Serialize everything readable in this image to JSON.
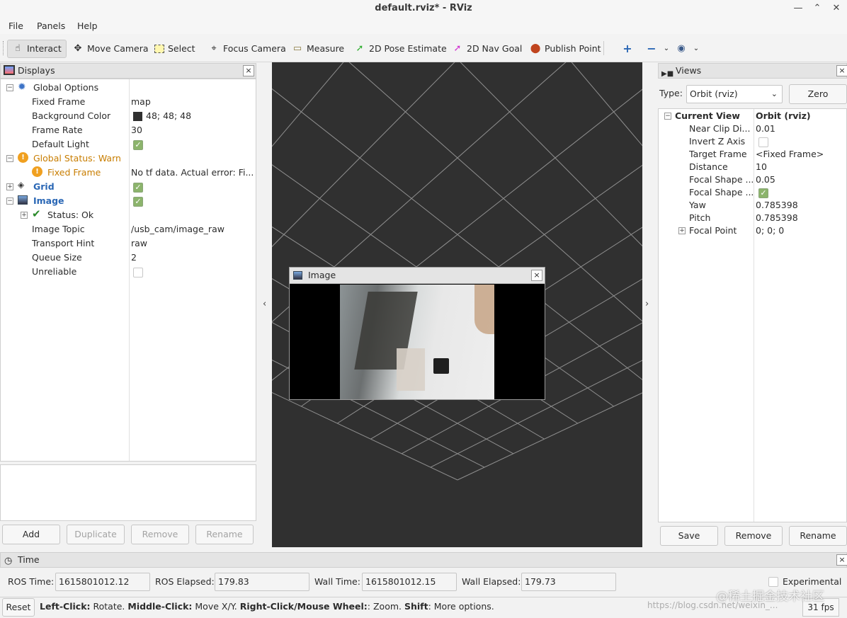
{
  "window": {
    "title": "default.rviz* - RViz"
  },
  "menu": {
    "file": "File",
    "panels": "Panels",
    "help": "Help"
  },
  "toolbar": {
    "interact": "Interact",
    "move_camera": "Move Camera",
    "select": "Select",
    "focus_camera": "Focus Camera",
    "measure": "Measure",
    "pose_estimate": "2D Pose Estimate",
    "nav_goal": "2D Nav Goal",
    "publish_point": "Publish Point"
  },
  "displays": {
    "title": "Displays",
    "rows": {
      "global_options": "Global Options",
      "fixed_frame": "Fixed Frame",
      "fixed_frame_val": "map",
      "background_color": "Background Color",
      "background_color_val": "48; 48; 48",
      "frame_rate": "Frame Rate",
      "frame_rate_val": "30",
      "default_light": "Default Light",
      "global_status": "Global Status: Warn",
      "fixed_frame_status": "Fixed Frame",
      "fixed_frame_status_val": "No tf data.  Actual error: Fi...",
      "grid": "Grid",
      "image": "Image",
      "status_ok": "Status: Ok",
      "image_topic": "Image Topic",
      "image_topic_val": "/usb_cam/image_raw",
      "transport_hint": "Transport Hint",
      "transport_hint_val": "raw",
      "queue_size": "Queue Size",
      "queue_size_val": "2",
      "unreliable": "Unreliable"
    },
    "buttons": {
      "add": "Add",
      "duplicate": "Duplicate",
      "remove": "Remove",
      "rename": "Rename"
    }
  },
  "image_window": {
    "title": "Image"
  },
  "views": {
    "title": "Views",
    "type_label": "Type:",
    "type_value": "Orbit (rviz)",
    "zero": "Zero",
    "rows": {
      "current_view": "Current View",
      "current_view_val": "Orbit (rviz)",
      "near_clip": "Near Clip Di...",
      "near_clip_val": "0.01",
      "invert_z": "Invert Z Axis",
      "target_frame": "Target Frame",
      "target_frame_val": "<Fixed Frame>",
      "distance": "Distance",
      "distance_val": "10",
      "focal_shape_1": "Focal Shape ...",
      "focal_shape_1_val": "0.05",
      "focal_shape_2": "Focal Shape ...",
      "yaw": "Yaw",
      "yaw_val": "0.785398",
      "pitch": "Pitch",
      "pitch_val": "0.785398",
      "focal_point": "Focal Point",
      "focal_point_val": "0; 0; 0"
    },
    "buttons": {
      "save": "Save",
      "remove": "Remove",
      "rename": "Rename"
    }
  },
  "time": {
    "title": "Time",
    "ros_time_label": "ROS Time:",
    "ros_time": "1615801012.12",
    "ros_elapsed_label": "ROS Elapsed:",
    "ros_elapsed": "179.83",
    "wall_time_label": "Wall Time:",
    "wall_time": "1615801012.15",
    "wall_elapsed_label": "Wall Elapsed:",
    "wall_elapsed": "179.73",
    "experimental": "Experimental"
  },
  "status": {
    "reset": "Reset",
    "left_click": "Left-Click:",
    "left_click_desc": " Rotate. ",
    "middle_click": "Middle-Click:",
    "middle_click_desc": " Move X/Y. ",
    "right_click": "Right-Click/Mouse Wheel:",
    "right_click_desc": ": Zoom. ",
    "shift": "Shift",
    "shift_desc": ": More options.",
    "fps": "31 fps"
  },
  "watermark": {
    "cn": "@稀土掘金技术社区",
    "url": "https://blog.csdn.net/weixin_..."
  },
  "colors": {
    "viewport_bg": "#303030",
    "grid": "#a0a0a0",
    "accent": "#2a67b5",
    "warn": "#c87d00",
    "check": "#8cb46c"
  }
}
